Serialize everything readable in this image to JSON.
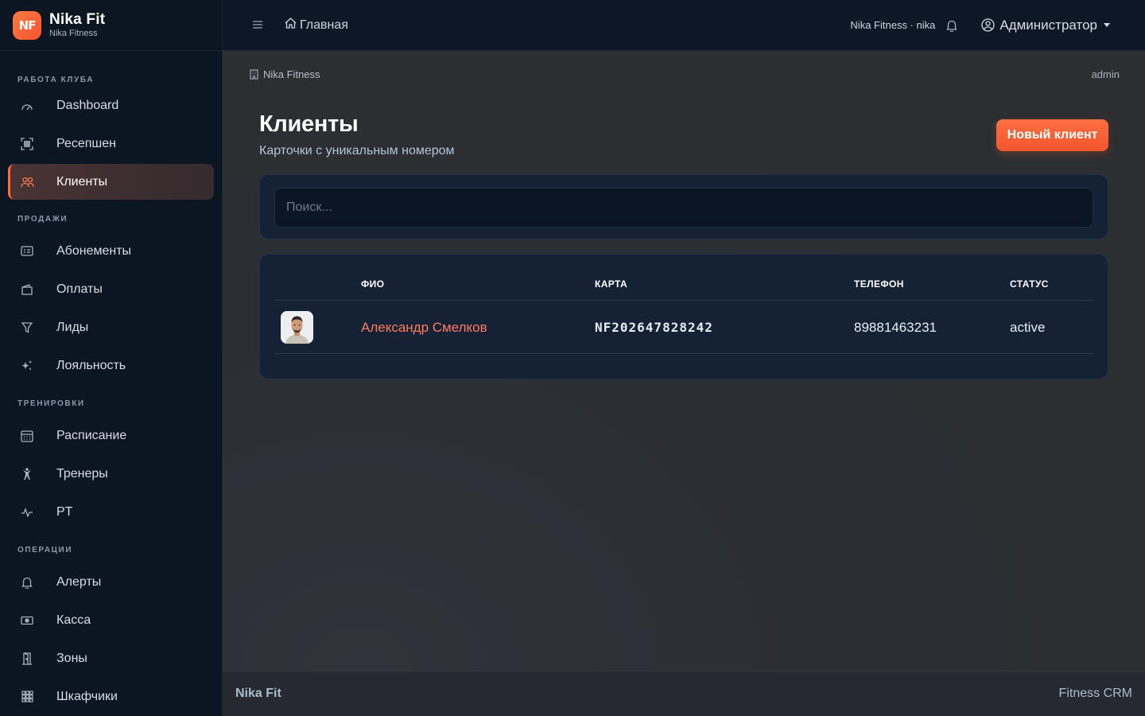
{
  "brand": {
    "logo": "NF",
    "title": "Nika Fit",
    "subtitle": "Nika Fitness"
  },
  "sidebar": {
    "sections": [
      {
        "title": "РАБОТА КЛУБА",
        "items": [
          {
            "label": "Dashboard",
            "icon": "dashboard-icon"
          },
          {
            "label": "Ресепшен",
            "icon": "reception-icon"
          },
          {
            "label": "Клиенты",
            "icon": "clients-icon",
            "active": true
          }
        ]
      },
      {
        "title": "ПРОДАЖИ",
        "items": [
          {
            "label": "Абонементы",
            "icon": "membership-icon"
          },
          {
            "label": "Оплаты",
            "icon": "wallet-icon"
          },
          {
            "label": "Лиды",
            "icon": "funnel-icon"
          },
          {
            "label": "Лояльность",
            "icon": "sparkles-icon"
          }
        ]
      },
      {
        "title": "ТРЕНИРОВКИ",
        "items": [
          {
            "label": "Расписание",
            "icon": "calendar-icon"
          },
          {
            "label": "Тренеры",
            "icon": "trainer-icon"
          },
          {
            "label": "PT",
            "icon": "pulse-icon"
          }
        ]
      },
      {
        "title": "ОПЕРАЦИИ",
        "items": [
          {
            "label": "Алерты",
            "icon": "bell-icon"
          },
          {
            "label": "Касса",
            "icon": "cash-icon"
          },
          {
            "label": "Зоны",
            "icon": "door-icon"
          },
          {
            "label": "Шкафчики",
            "icon": "lockers-icon"
          }
        ]
      }
    ]
  },
  "topbar": {
    "home": "Главная",
    "tenant": "Nika Fitness · nika",
    "user": "Администратор"
  },
  "breadcrumb": {
    "club": "Nika Fitness",
    "user": "admin"
  },
  "page": {
    "title": "Клиенты",
    "subtitle": "Карточки с уникальным номером",
    "new_button": "Новый клиент"
  },
  "search": {
    "placeholder": "Поиск..."
  },
  "table": {
    "headers": {
      "name": "ФИО",
      "card": "КАРТА",
      "phone": "ТЕЛЕФОН",
      "status": "СТАТУС"
    },
    "rows": [
      {
        "name": "Александр Смелков",
        "card": "NF202647828242",
        "phone": "89881463231",
        "status": "active"
      }
    ]
  },
  "footer": {
    "brand": "Nika Fit",
    "right": "Fitness CRM"
  },
  "colors": {
    "accent": "#ff6a3d",
    "sidebar_bg": "#0c1522",
    "card_bg": "#152236"
  }
}
